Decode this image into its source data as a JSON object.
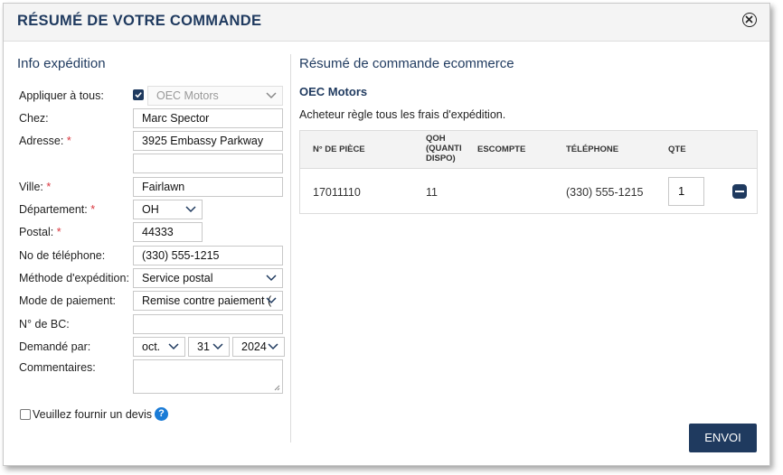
{
  "dialog": {
    "title": "RÉSUMÉ DE VOTRE COMMANDE"
  },
  "shipping": {
    "section_title": "Info expédition",
    "apply_all_label": "Appliquer à tous:",
    "apply_all_checked": true,
    "apply_all_value": "OEC Motors",
    "chez_label": "Chez:",
    "chez_value": "Marc Spector",
    "address_label": "Adresse:",
    "address_line1": "3925 Embassy Parkway",
    "address_line2": "",
    "required_mark": "*",
    "city_label": "Ville:",
    "city_value": "Fairlawn",
    "state_label": "Département:",
    "state_value": "OH",
    "postal_label": "Postal:",
    "postal_value": "44333",
    "phone_label": "No de téléphone:",
    "phone_value": "(330) 555-1215",
    "ship_method_label": "Méthode d'expédition:",
    "ship_method_value": "Service postal",
    "payment_label": "Mode de paiement:",
    "payment_value": "Remise contre paiement (",
    "po_label": "N° de BC:",
    "po_value": "",
    "requested_by_label": "Demandé par:",
    "requested_month": "oct.",
    "requested_day": "31",
    "requested_year": "2024",
    "comments_label": "Commentaires:",
    "comments_value": "",
    "quote_label": "Veuillez fournir un devis",
    "quote_checked": false,
    "help_icon": "question-icon"
  },
  "summary": {
    "section_title": "Résumé de commande ecommerce",
    "vendor": "OEC Motors",
    "note": "Acheteur règle tous les frais d'expédition.",
    "columns": {
      "part": "N° DE PIÈCE",
      "qoh": [
        "QOH",
        "(QUANTI",
        "DISPO)"
      ],
      "discount": "ESCOMPTE",
      "phone": "TÉLÉPHONE",
      "qty": "QTE"
    },
    "rows": [
      {
        "part": "17011110",
        "qoh": "11",
        "discount": "",
        "phone": "(330) 555-1215",
        "qty": "1"
      }
    ]
  },
  "actions": {
    "submit_label": "ENVOI"
  },
  "colors": {
    "brand": "#1f3a5f",
    "required": "#d9363e",
    "help": "#1a7bd6"
  }
}
